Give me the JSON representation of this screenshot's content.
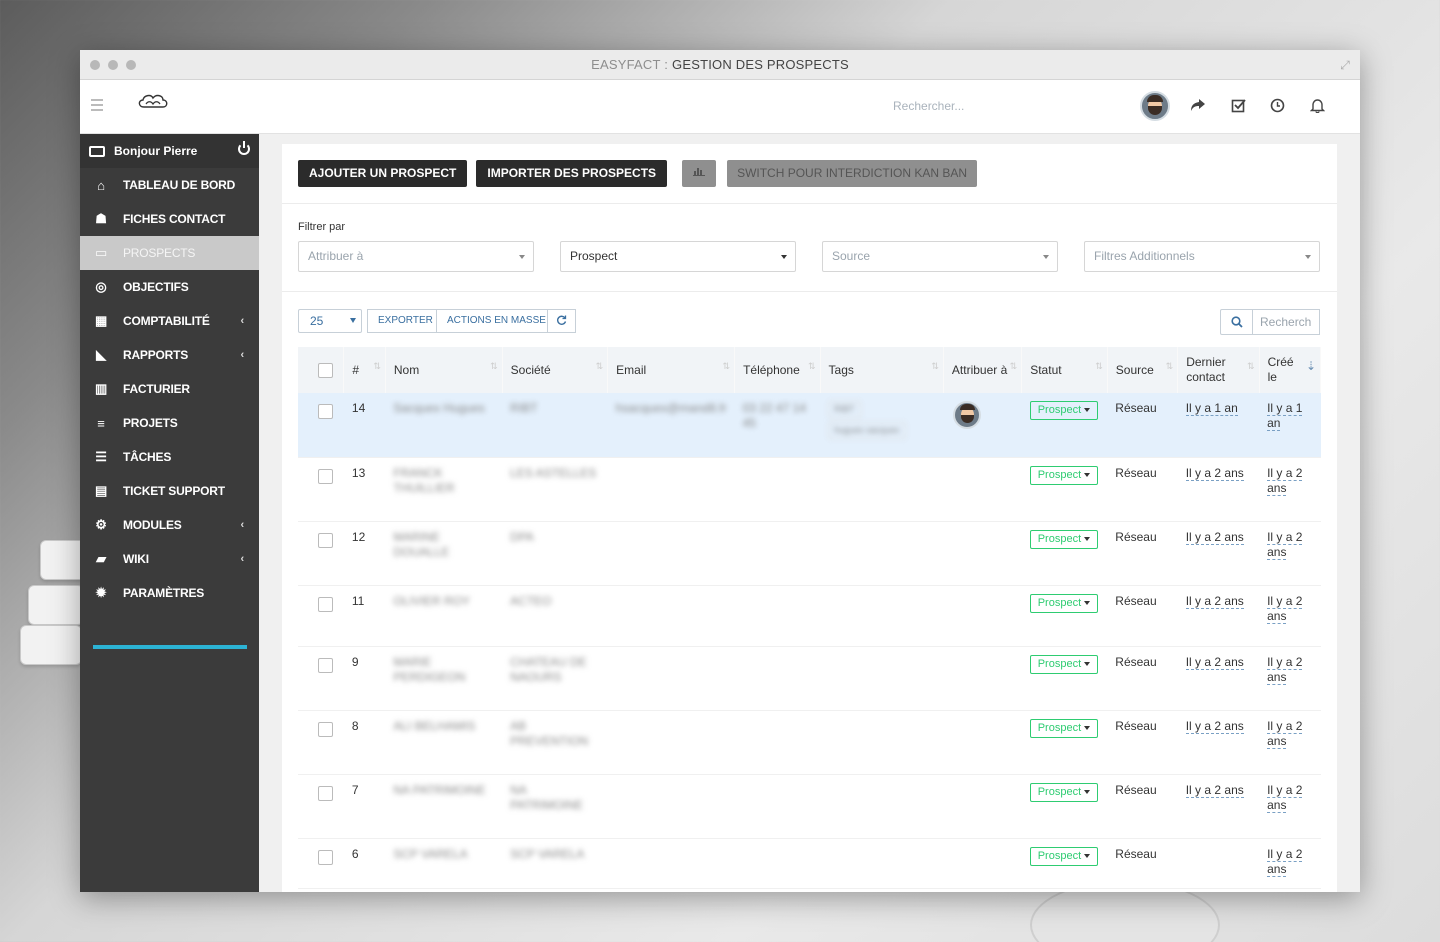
{
  "window": {
    "title_app": "EASYFACT :",
    "title_page": "GESTION DES PROSPECTS"
  },
  "topbar": {
    "search_placeholder": "Rechercher...",
    "icons": [
      "avatar",
      "share-icon",
      "check-square-icon",
      "clock-icon",
      "bell-icon"
    ]
  },
  "sidebar": {
    "greeting": "Bonjour Pierre",
    "items": [
      {
        "label": "TABLEAU DE BORD",
        "icon": "home-icon",
        "chevron": false,
        "active": false
      },
      {
        "label": "FICHES CONTACT",
        "icon": "users-icon",
        "chevron": false,
        "active": false
      },
      {
        "label": "PROSPECTS",
        "icon": "drive-icon",
        "chevron": false,
        "active": true
      },
      {
        "label": "OBJECTIFS",
        "icon": "target-icon",
        "chevron": false,
        "active": false
      },
      {
        "label": "COMPTABILITÉ",
        "icon": "calculator-icon",
        "chevron": true,
        "active": false
      },
      {
        "label": "RAPPORTS",
        "icon": "area-chart-icon",
        "chevron": true,
        "active": false
      },
      {
        "label": "FACTURIER",
        "icon": "bar-chart-icon",
        "chevron": false,
        "active": false
      },
      {
        "label": "PROJETS",
        "icon": "bars-icon",
        "chevron": false,
        "active": false
      },
      {
        "label": "TÂCHES",
        "icon": "tasks-icon",
        "chevron": false,
        "active": false
      },
      {
        "label": "TICKET SUPPORT",
        "icon": "ticket-icon",
        "chevron": false,
        "active": false
      },
      {
        "label": "MODULES",
        "icon": "cogs-icon",
        "chevron": true,
        "active": false
      },
      {
        "label": "WIKI",
        "icon": "book-icon",
        "chevron": true,
        "active": false
      },
      {
        "label": "PARAMÈTRES",
        "icon": "cog-icon",
        "chevron": false,
        "active": false
      }
    ]
  },
  "toolbar": {
    "add_label": "AJOUTER UN PROSPECT",
    "import_label": "IMPORTER DES PROSPECTS",
    "switch_label": "SWITCH POUR INTERDICTION KAN BAN"
  },
  "filters": {
    "label": "Filtrer par",
    "assign_placeholder": "Attribuer à",
    "status_value": "Prospect",
    "source_placeholder": "Source",
    "extra_placeholder": "Filtres Additionnels"
  },
  "table_tools": {
    "page_length": "25",
    "export_label": "EXPORTER",
    "mass_actions_label": "ACTIONS EN MASSE",
    "search_placeholder": "Recherch"
  },
  "table": {
    "columns": [
      "#",
      "Nom",
      "Société",
      "Email",
      "Téléphone",
      "Tags",
      "Attribuer à",
      "Statut",
      "Source",
      "Dernier contact",
      "Créé le"
    ],
    "rows": [
      {
        "num": "14",
        "nom": "Sacquex Hugues",
        "societe": "RIBT",
        "email": "hsacquex@mand8.fr",
        "tel": "03 22 47 14 45",
        "tags": [
          "RIBT",
          "hugues sacquex"
        ],
        "statut": "Prospect",
        "source": "Réseau",
        "dernier": "Il y a 1 an",
        "cree": "Il y a 1 an",
        "selected": true,
        "avatar": true
      },
      {
        "num": "13",
        "nom": "FRANCK THUILLIER",
        "societe": "LES ASTELLES",
        "email": "",
        "tel": "",
        "tags": [],
        "statut": "Prospect",
        "source": "Réseau",
        "dernier": "Il y a 2 ans",
        "cree": "Il y a 2 ans",
        "selected": false,
        "avatar": false
      },
      {
        "num": "12",
        "nom": "MARINE DOUALLE",
        "societe": "DPA",
        "email": "",
        "tel": "",
        "tags": [],
        "statut": "Prospect",
        "source": "Réseau",
        "dernier": "Il y a 2 ans",
        "cree": "Il y a 2 ans",
        "selected": false,
        "avatar": false
      },
      {
        "num": "11",
        "nom": "OLIVIER ROY",
        "societe": "ACTEO",
        "email": "",
        "tel": "",
        "tags": [],
        "statut": "Prospect",
        "source": "Réseau",
        "dernier": "Il y a 2 ans",
        "cree": "Il y a 2 ans",
        "selected": false,
        "avatar": false
      },
      {
        "num": "9",
        "nom": "MARIE PERDIGEON",
        "societe": "CHATEAU DE NAOURS",
        "email": "",
        "tel": "",
        "tags": [],
        "statut": "Prospect",
        "source": "Réseau",
        "dernier": "Il y a 2 ans",
        "cree": "Il y a 2 ans",
        "selected": false,
        "avatar": false
      },
      {
        "num": "8",
        "nom": "ALI BELHAMIS",
        "societe": "AB PREVENTION",
        "email": "",
        "tel": "",
        "tags": [],
        "statut": "Prospect",
        "source": "Réseau",
        "dernier": "Il y a 2 ans",
        "cree": "Il y a 2 ans",
        "selected": false,
        "avatar": false
      },
      {
        "num": "7",
        "nom": "NA PATRIMOINE",
        "societe": "NA PATRIMOINE",
        "email": "",
        "tel": "",
        "tags": [],
        "statut": "Prospect",
        "source": "Réseau",
        "dernier": "Il y a 2 ans",
        "cree": "Il y a 2 ans",
        "selected": false,
        "avatar": false
      },
      {
        "num": "6",
        "nom": "SCP VARELA",
        "societe": "SCP VARELA",
        "email": "",
        "tel": "",
        "tags": [],
        "statut": "Prospect",
        "source": "Réseau",
        "dernier": "",
        "cree": "Il y a 2 ans",
        "selected": false,
        "avatar": false
      }
    ]
  },
  "colors": {
    "sidebar_bg": "#3b3b3b",
    "accent_progress": "#2cb3d4",
    "status_green": "#2ecc71",
    "selected_row": "#e4f0fc"
  }
}
